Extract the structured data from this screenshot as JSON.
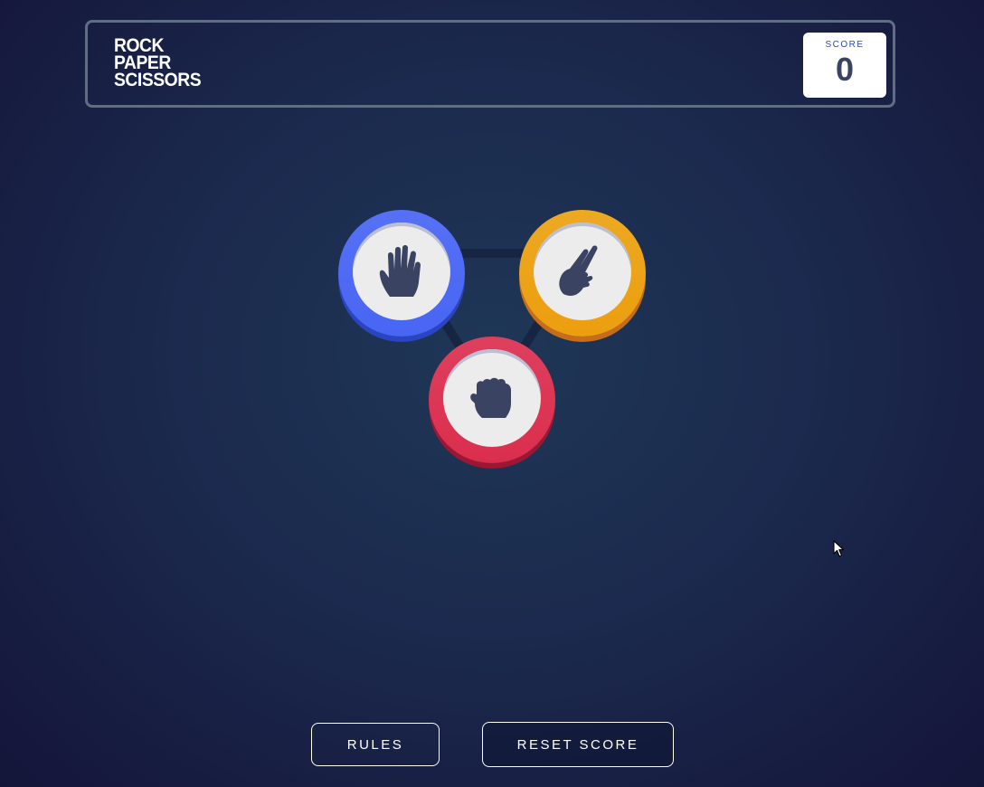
{
  "header": {
    "title_lines": [
      "ROCK",
      "PAPER",
      "SCISSORS"
    ],
    "score_label": "SCORE",
    "score_value": "0"
  },
  "choices": [
    {
      "id": "paper",
      "icon": "paper-hand-icon",
      "color": "#4865f4"
    },
    {
      "id": "scissors",
      "icon": "scissors-hand-icon",
      "color": "#ec9e0e"
    },
    {
      "id": "rock",
      "icon": "rock-hand-icon",
      "color": "#db2e4d"
    }
  ],
  "buttons": {
    "rules_label": "RULES",
    "reset_label": "RESET SCORE"
  },
  "colors": {
    "background": "#1f3756",
    "outline": "#606e85",
    "text_dark": "#3b4363",
    "score_text": "#2a46c0"
  }
}
